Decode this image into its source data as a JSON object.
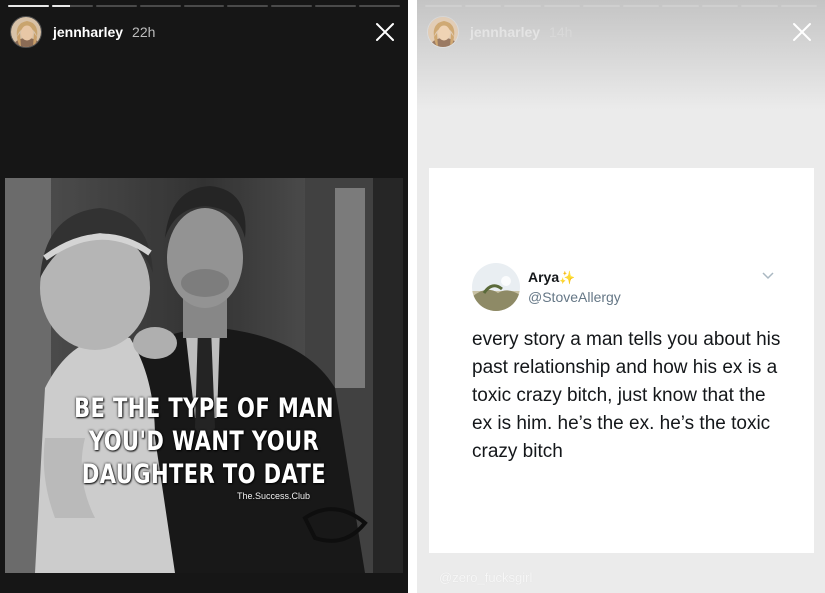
{
  "left_story": {
    "progress": {
      "segments": 9,
      "active_index": 1,
      "active_fraction": 0.45
    },
    "username": "jennharley",
    "time_ago": "22h",
    "quote_lines": [
      "BE THE TYPE OF MAN",
      "YOU'D WANT YOUR",
      "DAUGHTER TO DATE"
    ],
    "brand": "The.Success.Club",
    "icons": {
      "close": "close-icon",
      "avatar": "profile-avatar"
    }
  },
  "right_story": {
    "progress": {
      "segments": 10,
      "active_index": 0,
      "active_fraction": 0.0
    },
    "username": "jennharley",
    "time_ago": "14h",
    "tweet": {
      "display_name": "Arya",
      "sparkle": "✨",
      "handle": "@StoveAllergy",
      "text": "every story a man tells you about his past relationship and how his ex is a toxic crazy bitch, just know that the ex is him. he’s the ex. he’s the toxic crazy bitch"
    },
    "watermark": "@zero_fucksgirl",
    "icons": {
      "close": "close-icon",
      "tweet_menu": "chevron-down-icon"
    }
  },
  "colors": {
    "left_bg": "#161616",
    "right_bg": "#ebebeb",
    "tweet_text": "#14171a",
    "tweet_handle": "#657786"
  }
}
